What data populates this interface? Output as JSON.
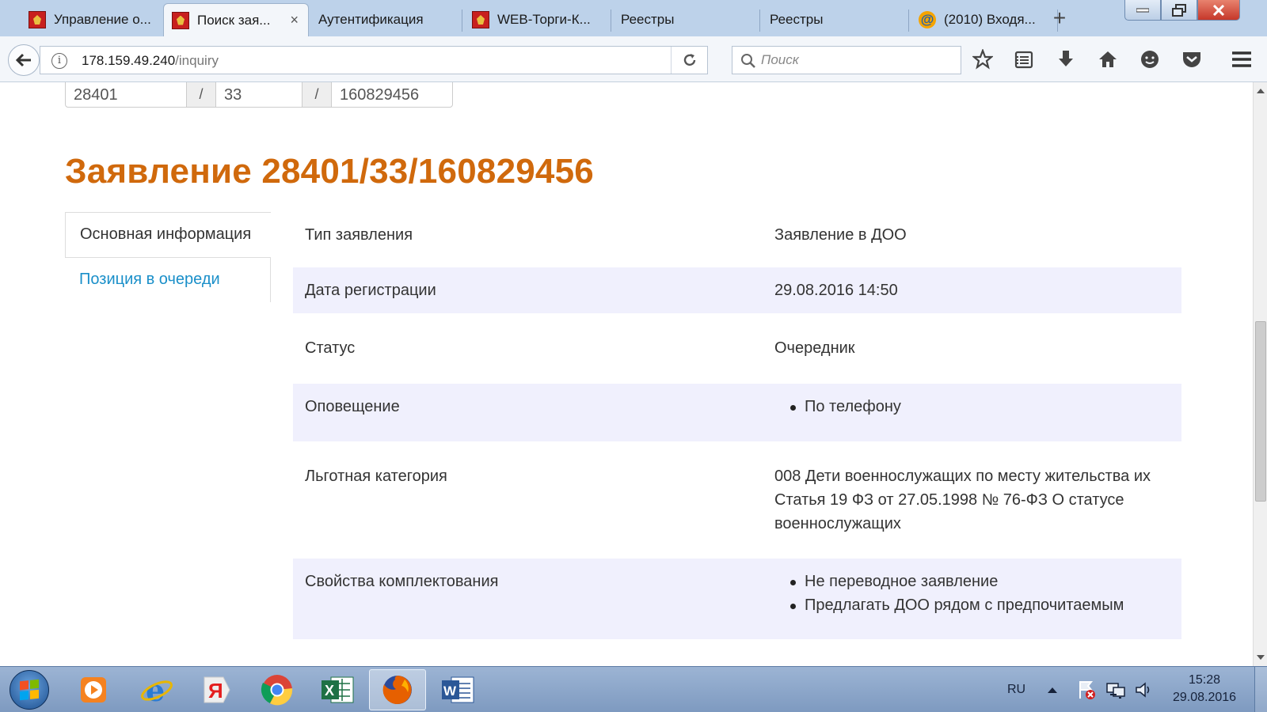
{
  "browser": {
    "tabs": [
      {
        "title": "Управление о...",
        "favicon": "red-crest-icon"
      },
      {
        "title": "Поиск зая...",
        "favicon": "red-crest-icon",
        "active": true
      },
      {
        "title": "Аутентификация",
        "favicon": ""
      },
      {
        "title": "WEB-Торги-К...",
        "favicon": "red-crest-icon"
      },
      {
        "title": "Реестры",
        "favicon": ""
      },
      {
        "title": "Реестры",
        "favicon": ""
      },
      {
        "title": "(2010) Входя...",
        "favicon": "mail-icon"
      }
    ],
    "new_tab_label": "+",
    "close_tab_label": "×",
    "url_host": "178.159.49.240",
    "url_path": "/inquiry",
    "search_placeholder": "Поиск"
  },
  "page": {
    "id_parts": [
      "28401",
      "33",
      "160829456"
    ],
    "id_separator": "/",
    "title": "Заявление 28401/33/160829456",
    "side_nav": [
      {
        "label": "Основная информация",
        "active": true
      },
      {
        "label": "Позиция в очереди",
        "active": false
      }
    ],
    "rows": [
      {
        "label": "Тип заявления",
        "value": "Заявление в ДОО"
      },
      {
        "label": "Дата регистрации",
        "value": "29.08.2016 14:50"
      },
      {
        "label": "Статус",
        "value": "Очередник"
      },
      {
        "label": "Оповещение",
        "items": [
          "По телефону"
        ]
      },
      {
        "label": "Льготная категория",
        "value": "008 Дети военнослужащих по месту жительства их Статья 19 ФЗ от 27.05.1998 № 76-ФЗ О статусе военнослужащих"
      },
      {
        "label": "Свойства комплектования",
        "items": [
          "Не переводное заявление",
          "Предлагать ДОО рядом с предпочитаемым"
        ]
      }
    ]
  },
  "taskbar": {
    "language": "RU",
    "time": "15:28",
    "date": "29.08.2016",
    "apps": [
      "media-player-icon",
      "internet-explorer-icon",
      "yandex-browser-icon",
      "chrome-icon",
      "excel-icon",
      "firefox-icon",
      "word-icon"
    ]
  },
  "colors": {
    "heading": "#d0690c",
    "link": "#1a8fc9",
    "row_shade": "#f0f0fd"
  }
}
